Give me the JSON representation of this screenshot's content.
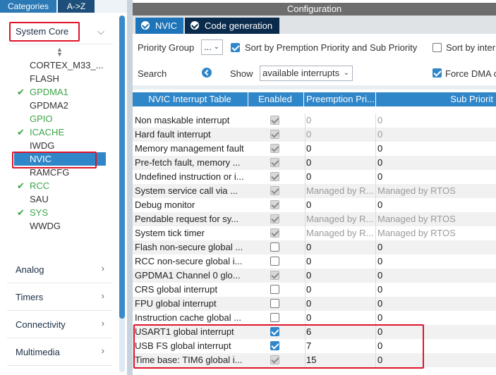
{
  "left_panel": {
    "tabs": {
      "categories": "Categories",
      "atoz": "A->Z"
    },
    "system_core": {
      "label": "System Core",
      "items": [
        {
          "label": "CORTEX_M33_...",
          "checked": false
        },
        {
          "label": "FLASH",
          "checked": false
        },
        {
          "label": "GPDMA1",
          "checked": true
        },
        {
          "label": "GPDMA2",
          "checked": false
        },
        {
          "label": "GPIO",
          "checked": false,
          "green": true
        },
        {
          "label": "ICACHE",
          "checked": true
        },
        {
          "label": "IWDG",
          "checked": false
        },
        {
          "label": "NVIC",
          "checked": false,
          "selected": true
        },
        {
          "label": "RAMCFG",
          "checked": false
        },
        {
          "label": "RCC",
          "checked": true
        },
        {
          "label": "SAU",
          "checked": false
        },
        {
          "label": "SYS",
          "checked": true
        },
        {
          "label": "WWDG",
          "checked": false
        }
      ]
    },
    "categories": [
      "Analog",
      "Timers",
      "Connectivity",
      "Multimedia"
    ]
  },
  "config": {
    "title": "Configuration",
    "tabs": {
      "nvic": "NVIC",
      "code_generation": "Code generation"
    },
    "priority_group_label": "Priority Group",
    "priority_group_value": "...",
    "sort_label": "Sort by Premption Priority and Sub Priority",
    "sort_by_label": "Sort by inter",
    "search_label": "Search",
    "show_label": "Show",
    "show_value": "available interrupts",
    "force_dma_label": "Force DMA c"
  },
  "table": {
    "headers": {
      "name": "NVIC Interrupt Table",
      "enabled": "Enabled",
      "preemption": "Preemption Pri...",
      "sub": "Sub Priorit"
    },
    "rows": [
      {
        "name": "Non maskable interrupt",
        "enabled": true,
        "locked": true,
        "pre": "0",
        "sub": "0",
        "dim": true
      },
      {
        "name": "Hard fault interrupt",
        "enabled": true,
        "locked": true,
        "pre": "0",
        "sub": "0",
        "dim": true
      },
      {
        "name": "Memory management fault",
        "enabled": true,
        "locked": true,
        "pre": "0",
        "sub": "0",
        "dim": false
      },
      {
        "name": "Pre-fetch fault, memory ...",
        "enabled": true,
        "locked": true,
        "pre": "0",
        "sub": "0",
        "dim": false
      },
      {
        "name": "Undefined instruction or i...",
        "enabled": true,
        "locked": true,
        "pre": "0",
        "sub": "0",
        "dim": false
      },
      {
        "name": "System service call via ...",
        "enabled": true,
        "locked": true,
        "pre": "Managed by R...",
        "sub": "Managed by RTOS",
        "dim": true
      },
      {
        "name": "Debug monitor",
        "enabled": true,
        "locked": true,
        "pre": "0",
        "sub": "0",
        "dim": false
      },
      {
        "name": "Pendable request for sy...",
        "enabled": true,
        "locked": true,
        "pre": "Managed by R...",
        "sub": "Managed by RTOS",
        "dim": true
      },
      {
        "name": "System tick timer",
        "enabled": true,
        "locked": true,
        "pre": "Managed by R...",
        "sub": "Managed by RTOS",
        "dim": true
      },
      {
        "name": "Flash non-secure global ...",
        "enabled": false,
        "locked": false,
        "pre": "0",
        "sub": "0",
        "dim": false
      },
      {
        "name": "RCC non-secure global i...",
        "enabled": false,
        "locked": false,
        "pre": "0",
        "sub": "0",
        "dim": false
      },
      {
        "name": "GPDMA1 Channel 0 glo...",
        "enabled": true,
        "locked": true,
        "pre": "0",
        "sub": "0",
        "dim": false
      },
      {
        "name": "CRS global interrupt",
        "enabled": false,
        "locked": false,
        "pre": "0",
        "sub": "0",
        "dim": false
      },
      {
        "name": "FPU global interrupt",
        "enabled": false,
        "locked": false,
        "pre": "0",
        "sub": "0",
        "dim": false
      },
      {
        "name": "Instruction cache global ...",
        "enabled": false,
        "locked": false,
        "pre": "0",
        "sub": "0",
        "dim": false
      },
      {
        "name": "USART1 global interrupt",
        "enabled": true,
        "locked": false,
        "pre": "6",
        "sub": "0",
        "dim": false
      },
      {
        "name": "USB FS global interrupt",
        "enabled": true,
        "locked": false,
        "pre": "7",
        "sub": "0",
        "dim": false
      },
      {
        "name": "Time base: TIM6 global i...",
        "enabled": true,
        "locked": true,
        "pre": "15",
        "sub": "0",
        "dim": false
      }
    ]
  }
}
